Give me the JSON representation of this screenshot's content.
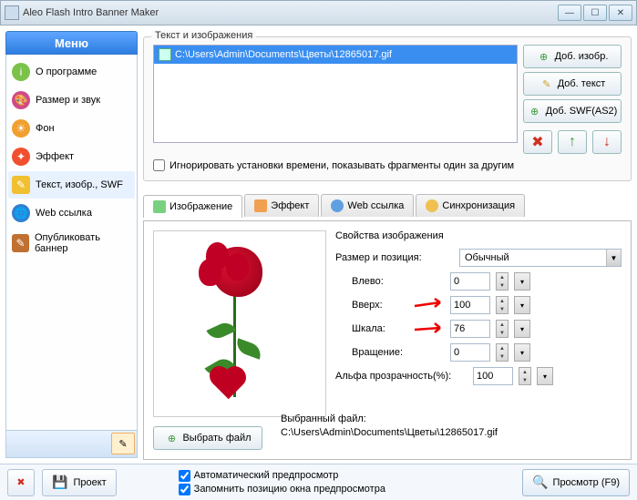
{
  "window": {
    "title": "Aleo Flash Intro Banner Maker"
  },
  "menu": {
    "header": "Меню",
    "items": [
      {
        "label": "О программе"
      },
      {
        "label": "Размер и звук"
      },
      {
        "label": "Фон"
      },
      {
        "label": "Эффект"
      },
      {
        "label": "Текст, изобр., SWF"
      },
      {
        "label": "Web ссылка"
      },
      {
        "label": "Опубликовать баннер"
      }
    ]
  },
  "section": {
    "title": "Текст и изображения",
    "file": "C:\\Users\\Admin\\Documents\\Цветы\\12865017.gif"
  },
  "buttons": {
    "addimg": "Доб. изобр.",
    "addtext": "Доб. текст",
    "addswf": "Доб. SWF(AS2)",
    "choose": "Выбрать файл",
    "project": "Проект",
    "preview": "Просмотр (F9)"
  },
  "ignore": "Игнорировать установки времени, показывать фрагменты один за другим",
  "tabs": {
    "img": "Изображение",
    "eff": "Эффект",
    "web": "Web ссылка",
    "sync": "Синхронизация"
  },
  "props": {
    "title": "Свойства изображения",
    "sizepos": "Размер и позиция:",
    "mode": "Обычный",
    "left": "Влево:",
    "leftv": "0",
    "top": "Вверх:",
    "topv": "100",
    "scale": "Шкала:",
    "scalev": "76",
    "rot": "Вращение:",
    "rotv": "0",
    "alpha": "Альфа прозрачность(%):",
    "alphav": "100"
  },
  "selected": {
    "label": "Выбранный файл:",
    "path": "C:\\Users\\Admin\\Documents\\Цветы\\12865017.gif"
  },
  "footer": {
    "auto": "Автоматический предпросмотр",
    "remember": "Запомнить позицию окна предпросмотра"
  }
}
